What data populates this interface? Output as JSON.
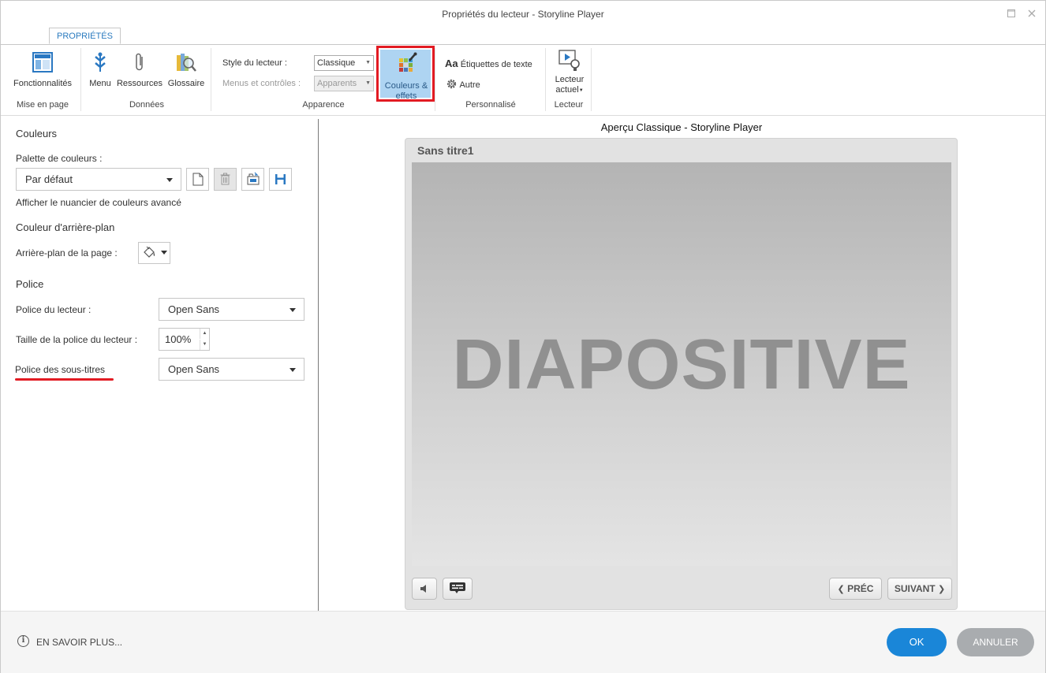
{
  "window": {
    "title": "Propriétés du lecteur - Storyline Player"
  },
  "ribbon": {
    "tab": "PROPRIÉTÉS",
    "groups": {
      "layout": "Mise en page",
      "data": "Données",
      "appearance": "Apparence",
      "custom": "Personnalisé",
      "player": "Lecteur"
    },
    "buttons": {
      "features": "Fonctionnalités",
      "menu": "Menu",
      "resources": "Ressources",
      "glossary": "Glossaire",
      "colors_line1": "Couleurs &",
      "colors_line2": "effets",
      "text_labels": "Étiquettes de texte",
      "other": "Autre",
      "current_player_line1": "Lecteur",
      "current_player_line2": "actuel"
    },
    "style_label": "Style du lecteur :",
    "style_value": "Classique",
    "menus_label": "Menus et contrôles :",
    "menus_value": "Apparents",
    "aa_glyph": "Aa"
  },
  "left": {
    "colors_heading": "Couleurs",
    "palette_label": "Palette de couleurs :",
    "palette_value": "Par défaut",
    "advanced_link": "Afficher le nuancier de couleurs avancé",
    "bg_heading": "Couleur d'arrière-plan",
    "bg_label": "Arrière-plan de la page :",
    "font_heading": "Police",
    "player_font_label": "Police du lecteur :",
    "player_font_value": "Open Sans",
    "font_size_label": "Taille de la police du lecteur :",
    "font_size_value": "100%",
    "subtitle_font_label": "Police des sous-titres",
    "subtitle_font_value": "Open Sans"
  },
  "preview": {
    "title": "Aperçu Classique - Storyline Player",
    "player_title": "Sans titre1",
    "slide_text": "DIAPOSITIVE",
    "prev": "PRÉC",
    "next": "SUIVANT"
  },
  "footer": {
    "learn_more": "EN SAVOIR PLUS...",
    "ok": "OK",
    "cancel": "ANNULER"
  },
  "colors": {
    "accent_blue": "#1a86d8",
    "highlight_red": "#e21b23",
    "selected_bg": "#aed4f2"
  }
}
